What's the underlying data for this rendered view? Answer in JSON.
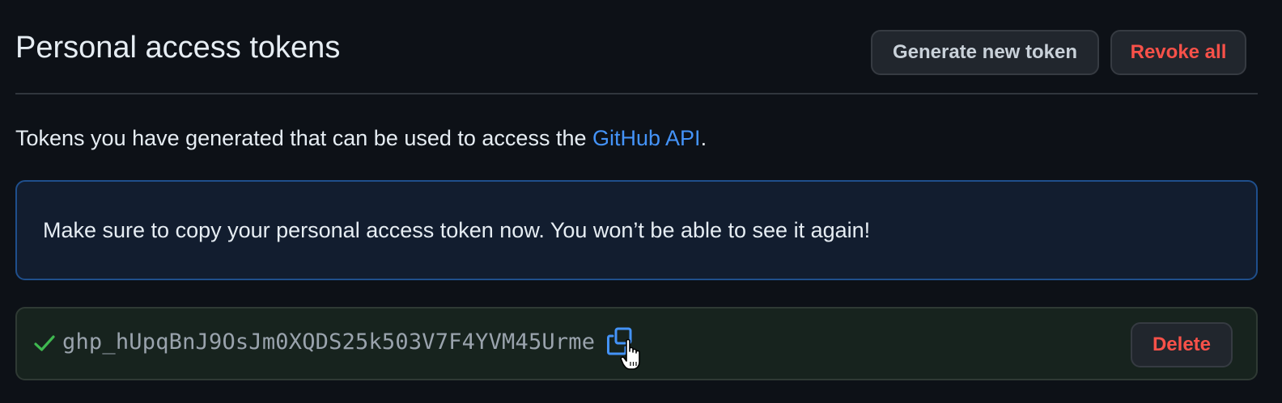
{
  "header": {
    "title": "Personal access tokens",
    "generate_label": "Generate new token",
    "revoke_label": "Revoke all"
  },
  "description": {
    "text": "Tokens you have generated that can be used to access the ",
    "link_text": "GitHub API",
    "suffix": "."
  },
  "notice": {
    "text": "Make sure to copy your personal access token now. You won’t be able to see it again!"
  },
  "token": {
    "value": "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",
    "delete_label": "Delete",
    "status_icon": "check-icon",
    "copy_icon": "copy-icon"
  },
  "colors": {
    "background": "#0d1117",
    "danger": "#f85149",
    "link": "#4493f8",
    "success": "#3fb950"
  }
}
